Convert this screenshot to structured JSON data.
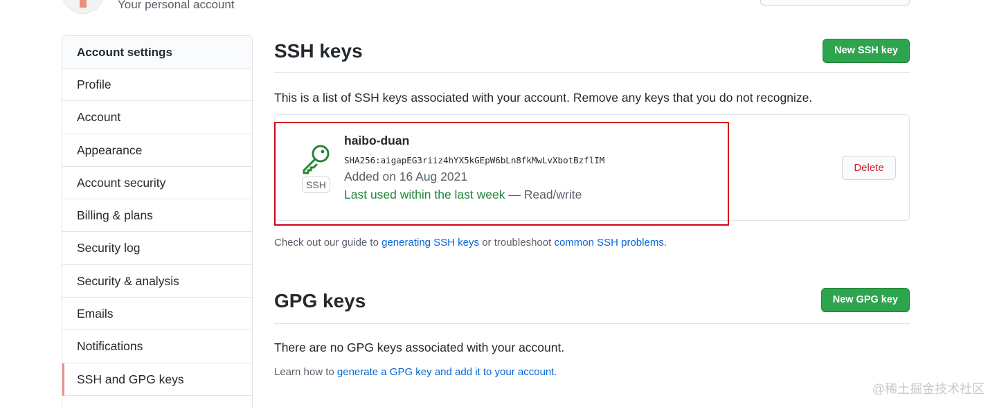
{
  "header": {
    "subtitle": "Your personal account"
  },
  "sidebar": {
    "title": "Account settings",
    "items": [
      {
        "label": "Profile"
      },
      {
        "label": "Account"
      },
      {
        "label": "Appearance"
      },
      {
        "label": "Account security"
      },
      {
        "label": "Billing & plans"
      },
      {
        "label": "Security log"
      },
      {
        "label": "Security & analysis"
      },
      {
        "label": "Emails"
      },
      {
        "label": "Notifications"
      },
      {
        "label": "SSH and GPG keys",
        "selected": true
      }
    ],
    "selected_accent": "#e8917f"
  },
  "ssh": {
    "title": "SSH keys",
    "new_button": "New SSH key",
    "description": "This is a list of SSH keys associated with your account. Remove any keys that you do not recognize.",
    "key": {
      "icon": "key-icon",
      "type_label": "SSH",
      "title": "haibo-duan",
      "fingerprint": "SHA256:aigapEG3riiz4hYX5kGEpW6bLn8fkMwLvXbotBzflIM",
      "added": "Added on 16 Aug 2021",
      "last_used": "Last used within the last week",
      "access": " — Read/write",
      "delete_label": "Delete"
    },
    "guide_prefix": "Check out our guide to ",
    "guide_link": "generating SSH keys",
    "guide_middle": " or troubleshoot ",
    "guide_link2": "common SSH problems",
    "guide_suffix": "."
  },
  "gpg": {
    "title": "GPG keys",
    "new_button": "New GPG key",
    "empty_text": "There are no GPG keys associated with your account.",
    "learn_prefix": "Learn how to ",
    "learn_link": "generate a GPG key and add it to your account",
    "learn_suffix": "."
  },
  "watermark": "@稀土掘金技术社区",
  "colors": {
    "primary_button": "#2ea44f",
    "link": "#0366d6",
    "danger": "#cb2431",
    "highlight_box": "#d0021b",
    "success_text": "#22863a"
  }
}
